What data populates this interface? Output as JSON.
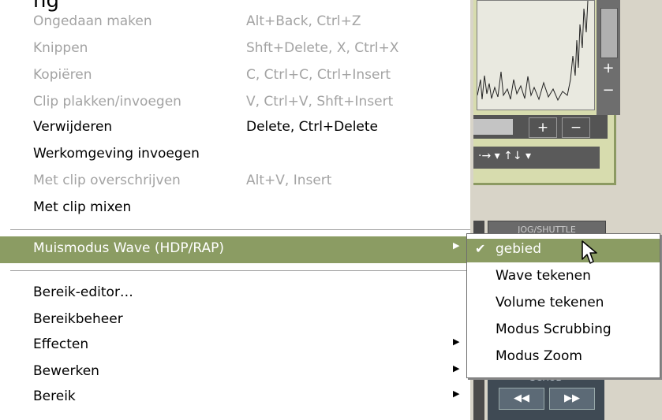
{
  "title_fragment": "ng",
  "menu": {
    "items": [
      {
        "label": "Ongedaan maken",
        "shortcut": "Alt+Back, Ctrl+Z",
        "disabled": true
      },
      {
        "label": "Knippen",
        "shortcut": "Shft+Delete, X, Ctrl+X",
        "disabled": true
      },
      {
        "label": "Kopiëren",
        "shortcut": "C, Ctrl+C, Ctrl+Insert",
        "disabled": true
      },
      {
        "label": "Clip plakken/invoegen",
        "shortcut": "V, Ctrl+V, Shft+Insert",
        "disabled": true
      },
      {
        "label": "Verwijderen",
        "shortcut": "Delete, Ctrl+Delete",
        "disabled": false
      },
      {
        "label": "Werkomgeving invoegen",
        "shortcut": "",
        "disabled": false
      },
      {
        "label": "Met clip overschrijven",
        "shortcut": "Alt+V, Insert",
        "disabled": true
      },
      {
        "label": "Met clip mixen",
        "shortcut": "",
        "disabled": false
      }
    ],
    "highlighted": {
      "label": "Muismodus Wave (HDP/RAP)",
      "submenu_arrow": "▶"
    },
    "lower_items": [
      {
        "label": "Bereik-editor…",
        "submenu": false
      },
      {
        "label": "Bereikbeheer",
        "submenu": false
      },
      {
        "label": "Effecten",
        "submenu": true
      },
      {
        "label": "Bewerken",
        "submenu": true
      },
      {
        "label": "Bereik",
        "submenu": true
      }
    ],
    "arrow_glyph": "▶"
  },
  "submenu": {
    "check_glyph": "✔",
    "items": [
      {
        "label": "gebied",
        "checked": true,
        "highlighted": true
      },
      {
        "label": "Wave tekenen",
        "checked": false,
        "highlighted": false
      },
      {
        "label": "Volume tekenen",
        "checked": false,
        "highlighted": false
      },
      {
        "label": "Modus Scrubbing",
        "checked": false,
        "highlighted": false
      },
      {
        "label": "Modus Zoom",
        "checked": false,
        "highlighted": false
      }
    ]
  },
  "background_app": {
    "zoom_plus": "+",
    "zoom_minus": "−",
    "scroll_plus": "+",
    "scroll_minus": "−",
    "nav_arrows": "·→ ▾ ↑↓ ▾",
    "shuttle_label": "JOG/SHUTTLE",
    "scrub_label": "SCRUB",
    "scrub_rewind": "◀◀",
    "scrub_forward": "▶▶"
  },
  "colors": {
    "highlight": "#8b9c63",
    "disabled_text": "#a3a3a3",
    "panel_green": "#d7dcae"
  }
}
